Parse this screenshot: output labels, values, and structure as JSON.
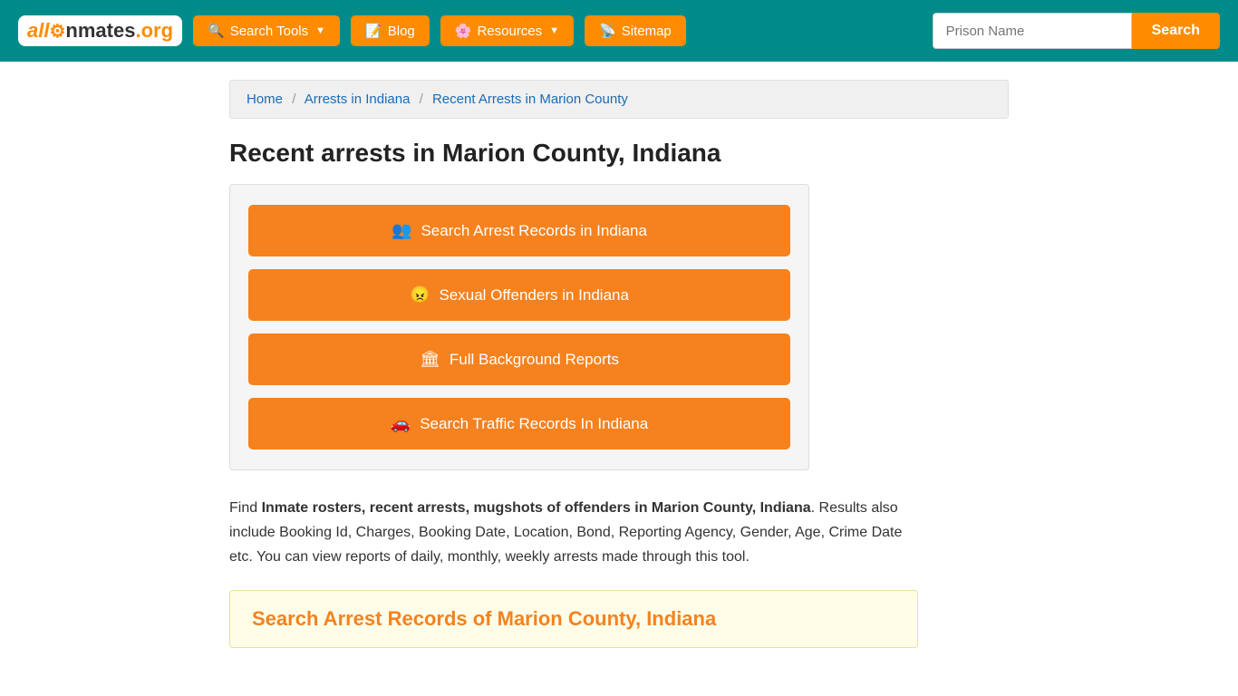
{
  "header": {
    "logo_text": "allInmates.org",
    "nav": {
      "search_tools_label": "Search Tools",
      "blog_label": "Blog",
      "resources_label": "Resources",
      "sitemap_label": "Sitemap"
    },
    "search_placeholder": "Prison Name",
    "search_button_label": "Search"
  },
  "breadcrumb": {
    "home": "Home",
    "arrests": "Arrests in Indiana",
    "current": "Recent Arrests in Marion County"
  },
  "page": {
    "title": "Recent arrests in Marion County, Indiana",
    "action_buttons": [
      {
        "label": "Search Arrest Records in Indiana",
        "icon": "👥"
      },
      {
        "label": "Sexual Offenders in Indiana",
        "icon": "😠"
      },
      {
        "label": "Full Background Reports",
        "icon": "🏛"
      },
      {
        "label": "Search Traffic Records In Indiana",
        "icon": "🚗"
      }
    ],
    "description_plain": ". Results also include Booking Id, Charges, Booking Date, Location, Bond, Reporting Agency, Gender, Age, Crime Date etc. You can view reports of daily, monthly, weekly arrests made through this tool.",
    "description_bold": "Inmate rosters, recent arrests, mugshots of offenders in Marion County, Indiana",
    "description_prefix": "Find ",
    "bottom_search_title": "Search Arrest Records of Marion County, Indiana"
  }
}
